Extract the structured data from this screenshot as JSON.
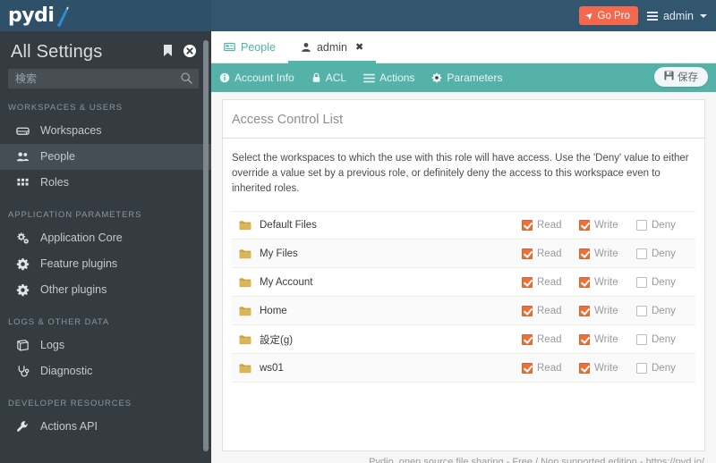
{
  "header": {
    "logo_text": "pydi",
    "logo_mark_icon": "pydio-feather-icon",
    "go_pro_label": "Go Pro",
    "go_pro_icon": "rocket-icon",
    "user_menu_label": "admin",
    "user_menu_icon": "hamburger-icon",
    "user_menu_caret_icon": "caret-down-icon",
    "brand_color": "#33566f",
    "accent_color": "#f4684e"
  },
  "sidebar": {
    "title": "All Settings",
    "bookmark_icon": "bookmark-icon",
    "close_icon": "close-circle-icon",
    "search": {
      "placeholder": "検索",
      "value": "",
      "icon": "search-icon"
    },
    "sections": [
      {
        "label": "WORKSPACES & USERS",
        "items": [
          {
            "label": "Workspaces",
            "icon": "drive-icon",
            "active": false
          },
          {
            "label": "People",
            "icon": "people-icon",
            "active": true
          },
          {
            "label": "Roles",
            "icon": "grid-icon",
            "active": false
          }
        ]
      },
      {
        "label": "APPLICATION PARAMETERS",
        "items": [
          {
            "label": "Application Core",
            "icon": "gears-icon",
            "active": false
          },
          {
            "label": "Feature plugins",
            "icon": "gear-icon",
            "active": false
          },
          {
            "label": "Other plugins",
            "icon": "gear-icon",
            "active": false
          }
        ]
      },
      {
        "label": "LOGS & OTHER DATA",
        "items": [
          {
            "label": "Logs",
            "icon": "book-icon",
            "active": false
          },
          {
            "label": "Diagnostic",
            "icon": "stethoscope-icon",
            "active": false
          }
        ]
      },
      {
        "label": "DEVELOPER RESOURCES",
        "items": [
          {
            "label": "Actions API",
            "icon": "wrench-icon",
            "active": false
          }
        ]
      }
    ]
  },
  "main": {
    "tabs": [
      {
        "label": "People",
        "icon": "card-icon",
        "active": false,
        "closable": false
      },
      {
        "label": "admin",
        "icon": "user-icon",
        "active": true,
        "closable": true,
        "close_icon": "close-x-icon"
      }
    ],
    "toolbar": {
      "items": [
        {
          "label": "Account Info",
          "icon": "info-icon"
        },
        {
          "label": "ACL",
          "icon": "lock-icon"
        },
        {
          "label": "Actions",
          "icon": "list-icon"
        },
        {
          "label": "Parameters",
          "icon": "gear-icon"
        }
      ],
      "save_label": "保存",
      "save_icon": "floppy-disk-icon",
      "bg_color": "#55b2a8"
    },
    "panel": {
      "title": "Access Control List",
      "description": "Select the workspaces to which the use with this role will have access. Use the 'Deny' value to either override a value set by a previous role, or definitely deny the access to this workspace even to inherited roles.",
      "permission_labels": {
        "read": "Read",
        "write": "Write",
        "deny": "Deny"
      },
      "folder_icon": "folder-icon",
      "rows": [
        {
          "name": "Default Files",
          "read": true,
          "write": true,
          "deny": false
        },
        {
          "name": "My Files",
          "read": true,
          "write": true,
          "deny": false
        },
        {
          "name": "My Account",
          "read": true,
          "write": true,
          "deny": false
        },
        {
          "name": "Home",
          "read": true,
          "write": true,
          "deny": false
        },
        {
          "name": "設定(g)",
          "read": true,
          "write": true,
          "deny": false
        },
        {
          "name": "ws01",
          "read": true,
          "write": true,
          "deny": false
        }
      ]
    },
    "footer_text": "Pydio, open source file sharing - Free / Non supported edition - https://pyd.io/"
  }
}
